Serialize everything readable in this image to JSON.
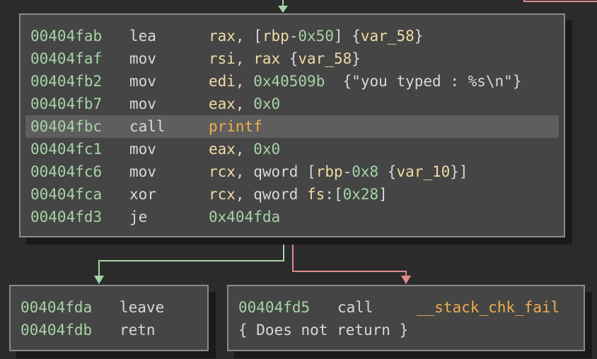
{
  "main_block": {
    "lines": [
      {
        "addr": "00404fab",
        "mnemonic": "lea",
        "ops": [
          [
            "reg",
            "rax"
          ],
          [
            "txt",
            ", ["
          ],
          [
            "reg",
            "rbp"
          ],
          [
            "txt",
            "-"
          ],
          [
            "num",
            "0x50"
          ],
          [
            "txt",
            "] {"
          ],
          [
            "reg",
            "var_58"
          ],
          [
            "txt",
            "}"
          ]
        ]
      },
      {
        "addr": "00404faf",
        "mnemonic": "mov",
        "ops": [
          [
            "reg",
            "rsi"
          ],
          [
            "txt",
            ", "
          ],
          [
            "reg",
            "rax"
          ],
          [
            "txt",
            " {"
          ],
          [
            "reg",
            "var_58"
          ],
          [
            "txt",
            "}"
          ]
        ]
      },
      {
        "addr": "00404fb2",
        "mnemonic": "mov",
        "ops": [
          [
            "reg",
            "edi"
          ],
          [
            "txt",
            ", "
          ],
          [
            "num",
            "0x40509b"
          ],
          [
            "txt",
            "  {\"you typed : %s\\n\"}"
          ]
        ]
      },
      {
        "addr": "00404fb7",
        "mnemonic": "mov",
        "ops": [
          [
            "reg",
            "eax"
          ],
          [
            "txt",
            ", "
          ],
          [
            "num",
            "0x0"
          ]
        ]
      },
      {
        "addr": "00404fbc",
        "mnemonic": "call",
        "ops": [
          [
            "fn",
            "printf"
          ]
        ],
        "highlighted": true
      },
      {
        "addr": "00404fc1",
        "mnemonic": "mov",
        "ops": [
          [
            "reg",
            "eax"
          ],
          [
            "txt",
            ", "
          ],
          [
            "num",
            "0x0"
          ]
        ]
      },
      {
        "addr": "00404fc6",
        "mnemonic": "mov",
        "ops": [
          [
            "reg",
            "rcx"
          ],
          [
            "txt",
            ", qword ["
          ],
          [
            "reg",
            "rbp"
          ],
          [
            "txt",
            "-"
          ],
          [
            "num",
            "0x8"
          ],
          [
            "txt",
            " {"
          ],
          [
            "reg",
            "var_10"
          ],
          [
            "txt",
            "}]"
          ]
        ]
      },
      {
        "addr": "00404fca",
        "mnemonic": "xor",
        "ops": [
          [
            "reg",
            "rcx"
          ],
          [
            "txt",
            ", qword "
          ],
          [
            "reg",
            "fs"
          ],
          [
            "txt",
            ":["
          ],
          [
            "num",
            "0x28"
          ],
          [
            "txt",
            "]"
          ]
        ]
      },
      {
        "addr": "00404fd3",
        "mnemonic": "je",
        "ops": [
          [
            "num",
            "0x404fda"
          ]
        ]
      }
    ]
  },
  "left_block": {
    "lines": [
      {
        "addr": "00404fda",
        "mnemonic": "leave",
        "ops": []
      },
      {
        "addr": "00404fdb",
        "mnemonic": "retn",
        "ops": []
      }
    ]
  },
  "right_block": {
    "lines": [
      {
        "addr": "00404fd5",
        "mnemonic": "call",
        "ops": [
          [
            "fn",
            "__stack_chk_fail"
          ]
        ]
      }
    ],
    "note": "{ Does not return }"
  },
  "colors": {
    "background": "#2b2b2b",
    "block": "#454545",
    "address": "#a6d4a6",
    "register": "#f0dca6",
    "function": "#f0ad4e",
    "edge_true": "#a6d4a6",
    "edge_false": "#e08a8a"
  }
}
